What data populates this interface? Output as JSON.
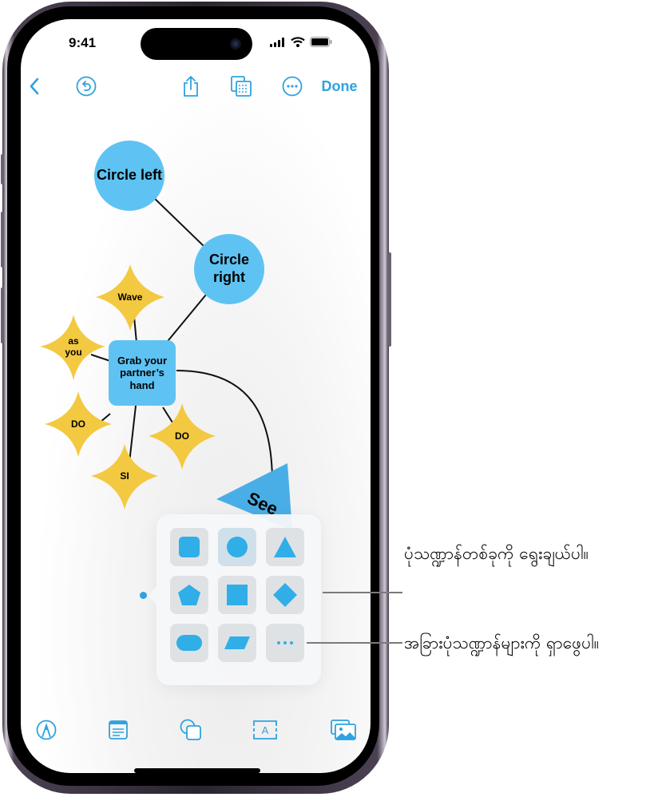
{
  "status_bar": {
    "time": "9:41",
    "icons": [
      "cellular-signal-icon",
      "wifi-icon",
      "battery-icon"
    ]
  },
  "top_toolbar": {
    "back_icon": "chevron-left-icon",
    "undo_icon": "undo-icon",
    "share_icon": "share-icon",
    "view_icon": "view-options-icon",
    "more_icon": "more-ellipsis-icon",
    "done_label": "Done"
  },
  "canvas": {
    "colors": {
      "circle_fill": "#5ec3f2",
      "star_fill": "#f3c942",
      "rect_fill": "#5ec3f2",
      "triangle_fill": "#4aaee6",
      "connector": "#111111"
    },
    "nodes": [
      {
        "id": "circle-left",
        "type": "circle",
        "label": "Circle left"
      },
      {
        "id": "circle-right",
        "type": "circle",
        "label": "Circle right"
      },
      {
        "id": "grab",
        "type": "rounded-rect",
        "label": "Grab your partner’s hand"
      },
      {
        "id": "wave",
        "type": "star",
        "label": "Wave"
      },
      {
        "id": "as-you",
        "type": "star",
        "label": "as you"
      },
      {
        "id": "do-left",
        "type": "star",
        "label": "DO"
      },
      {
        "id": "do-right",
        "type": "star",
        "label": "DO"
      },
      {
        "id": "si",
        "type": "star",
        "label": "SI"
      },
      {
        "id": "see",
        "type": "triangle",
        "label": "See"
      }
    ]
  },
  "shape_picker": {
    "shapes": [
      {
        "name": "rounded-square",
        "selected": false
      },
      {
        "name": "circle",
        "selected": true
      },
      {
        "name": "triangle",
        "selected": false
      },
      {
        "name": "pentagon",
        "selected": false
      },
      {
        "name": "square",
        "selected": false
      },
      {
        "name": "diamond",
        "selected": false
      },
      {
        "name": "pill",
        "selected": false
      },
      {
        "name": "parallelogram",
        "selected": false
      },
      {
        "name": "more-shapes",
        "selected": false
      }
    ],
    "accent_color": "#30aee8"
  },
  "bottom_toolbar": {
    "items": [
      "pen-tool-icon",
      "sticky-note-icon",
      "shapes-icon",
      "text-box-icon",
      "media-icon"
    ]
  },
  "callouts": {
    "select_shape": "ပုံသဏ္ဍာန်တစ်ခုကို ရွေးချယ်ပါ။",
    "more_shapes": "အခြားပုံသဏ္ဍာန်များကို ရှာဖွေပါ။"
  }
}
